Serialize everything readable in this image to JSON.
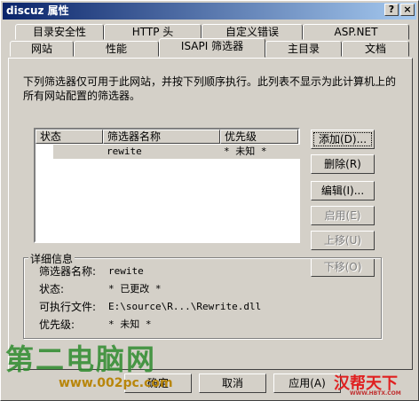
{
  "window": {
    "title": "discuz 属性",
    "help_btn": "?",
    "close_btn": "×"
  },
  "tabs_row1": [
    "目录安全性",
    "HTTP 头",
    "自定义错误",
    "ASP.NET"
  ],
  "tabs_row2": [
    "网站",
    "性能",
    "ISAPI 筛选器",
    "主目录",
    "文档"
  ],
  "description": "下列筛选器仅可用于此网站，并按下列顺序执行。此列表不显示为此计算机上的所有网站配置的筛选器。",
  "list": {
    "headers": [
      "状态",
      "筛选器名称",
      "优先级"
    ],
    "rows": [
      {
        "status": "",
        "name": "rewite",
        "priority": "* 未知 *"
      }
    ]
  },
  "side_buttons": {
    "add": "添加(D)...",
    "remove": "删除(R)",
    "edit": "编辑(I)...",
    "enable": "启用(E)",
    "move_up": "上移(U)",
    "move_down": "下移(O)"
  },
  "details": {
    "title": "详细信息",
    "name_label": "筛选器名称:",
    "name_value": "rewite",
    "status_label": "状态:",
    "status_value": "* 已更改 *",
    "exe_label": "可执行文件:",
    "exe_value": "E:\\source\\R...\\Rewrite.dll",
    "priority_label": "优先级:",
    "priority_value": "* 未知 *"
  },
  "bottom_buttons": {
    "ok": "确定",
    "cancel": "取消",
    "apply": "应用(A)"
  },
  "watermarks": {
    "left_logo": "第二电脑网",
    "left_url": "www.002pc.com",
    "right_logo": "汉帮天下",
    "right_sub": "WWW.HBTX.COM"
  }
}
